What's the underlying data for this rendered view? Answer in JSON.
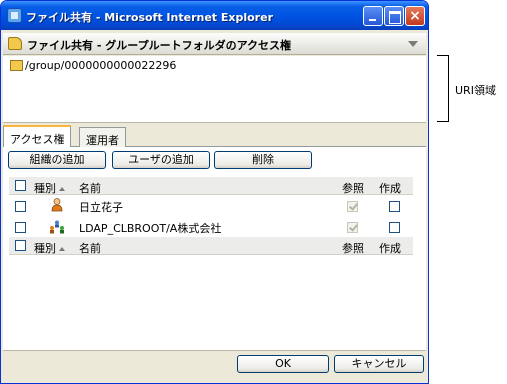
{
  "window": {
    "title": "ファイル共有 - Microsoft Internet Explorer"
  },
  "panel_header": {
    "title": "ファイル共有 - グループルートフォルダのアクセス権"
  },
  "uri_area": {
    "path": "/group/0000000000022296"
  },
  "annotation": {
    "label": "URI領域"
  },
  "tabs": [
    {
      "label": "アクセス権",
      "active": true
    },
    {
      "label": "運用者",
      "active": false
    }
  ],
  "toolbar": {
    "add_org": "組織の追加",
    "add_user": "ユーザの追加",
    "delete": "削除"
  },
  "table": {
    "columns": {
      "type": "種別",
      "name": "名前",
      "ref": "参照",
      "create": "作成"
    },
    "rows": [
      {
        "type_icon": "user-icon",
        "name": "日立花子",
        "ref_checked": true,
        "ref_disabled": true,
        "create_checked": false
      },
      {
        "type_icon": "organization-icon",
        "name": "LDAP_CLBROOT/A株式会社",
        "ref_checked": true,
        "ref_disabled": true,
        "create_checked": false
      }
    ]
  },
  "footer": {
    "ok": "OK",
    "cancel": "キャンセル"
  }
}
